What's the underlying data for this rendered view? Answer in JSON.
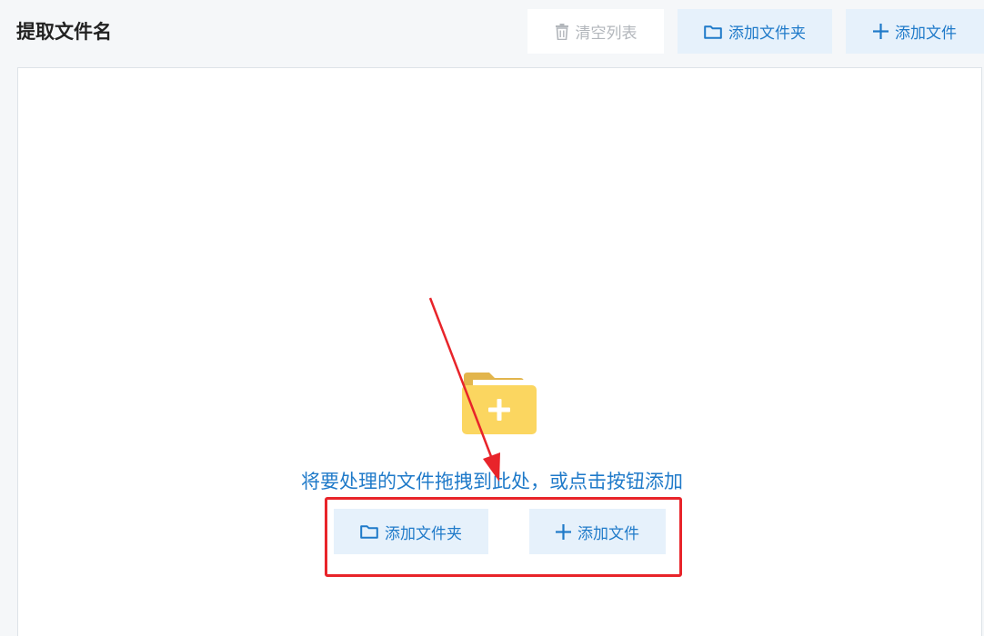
{
  "header": {
    "title": "提取文件名",
    "clear_label": "清空列表",
    "add_folder_label": "添加文件夹",
    "add_file_label": "添加文件"
  },
  "drop_area": {
    "hint": "将要处理的文件拖拽到此处，或点击按钮添加",
    "add_folder_label": "添加文件夹",
    "add_file_label": "添加文件"
  },
  "icons": {
    "clear": "trash-icon",
    "folder": "folder-icon",
    "plus": "plus-icon",
    "drop": "folder-add-icon"
  },
  "colors": {
    "accent": "#1f7ac9",
    "button_bg": "#e6f1fb",
    "disabled_text": "#b2b6bb",
    "annotation_red": "#e8242a",
    "folder_yellow": "#fbd660"
  }
}
